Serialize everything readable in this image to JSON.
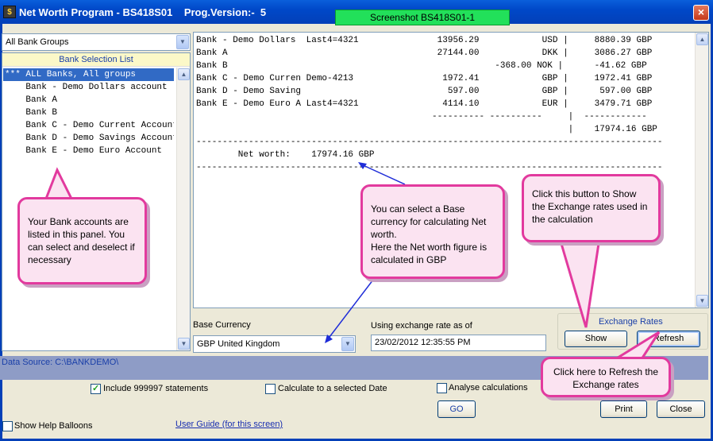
{
  "window": {
    "title": "Net Worth Program - BS418S01    Prog.Version:-  5",
    "app_icon": "app-icon",
    "close_glyph": "×",
    "screenshot_badge": "Screenshot BS418S01-1"
  },
  "bank_groups": {
    "selected": "All Bank Groups",
    "list_header": "Bank Selection List",
    "items": [
      {
        "label": "*** ALL Banks, All groups",
        "selected": true
      },
      {
        "label": "    Bank - Demo Dollars account",
        "selected": false
      },
      {
        "label": "    Bank A",
        "selected": false
      },
      {
        "label": "    Bank B",
        "selected": false
      },
      {
        "label": "    Bank C - Demo Current Account",
        "selected": false
      },
      {
        "label": "    Bank D - Demo Savings Account",
        "selected": false
      },
      {
        "label": "    Bank E - Demo Euro Account",
        "selected": false
      }
    ]
  },
  "report": {
    "lines": [
      "Bank - Demo Dollars  Last4=4321               13956.29            USD |     8880.39 GBP",
      "Bank A                                        27144.00            DKK |     3086.27 GBP",
      "Bank B                                                   -368.00 NOK |      -41.62 GBP",
      "Bank C - Demo Curren Demo-4213                 1972.41            GBP |     1972.41 GBP",
      "Bank D - Demo Saving                            597.00            GBP |      597.00 GBP",
      "Bank E - Demo Euro A Last4=4321                4114.10            EUR |     3479.71 GBP",
      "                                             ---------- ----------     |  ------------",
      "                                                                       |    17974.16 GBP",
      "-----------------------------------------------------------------------------------------",
      "        Net worth:    17974.16 GBP",
      "-----------------------------------------------------------------------------------------"
    ]
  },
  "base_currency": {
    "label": "Base Currency",
    "selected": "GBP United Kingdom"
  },
  "exchange_date": {
    "label": "Using exchange rate as of",
    "value": "23/02/2012 12:35:55 PM"
  },
  "exchange_rates": {
    "group_label": "Exchange Rates",
    "show_label": "Show",
    "refresh_label": "Refresh"
  },
  "data_source": "Data Source: C:\\BANKDEMO\\",
  "options": {
    "include_999997": {
      "label": "Include 999997 statements",
      "checked": true
    },
    "calc_selected_date": {
      "label": "Calculate to a selected Date",
      "checked": false
    },
    "analyse_calcs": {
      "label": "Analyse calculations",
      "checked": false
    },
    "show_help_balloons": {
      "label": "Show Help Balloons",
      "checked": false
    }
  },
  "buttons": {
    "go": "GO",
    "print": "Print",
    "close": "Close"
  },
  "user_guide_link": "User Guide (for this screen)",
  "balloons": {
    "bank_accounts": "Your Bank accounts are listed in this panel. You can select and deselect if necessary",
    "base_currency": "You can select a Base currency for calculating Net worth.\nHere the Net worth figure is calculated in GBP",
    "show_rates": "Click this button to Show the Exchange rates used in the calculation",
    "refresh_rates": "Click here to Refresh the Exchange rates"
  },
  "colors": {
    "titlebar": "#0048c8",
    "selection": "#316ac5",
    "balloon_border": "#e23a9e",
    "balloon_fill": "#fbe3f1",
    "badge": "#22e05a",
    "data_source_bar": "#8e9cc6",
    "link": "#1a2fb0"
  }
}
